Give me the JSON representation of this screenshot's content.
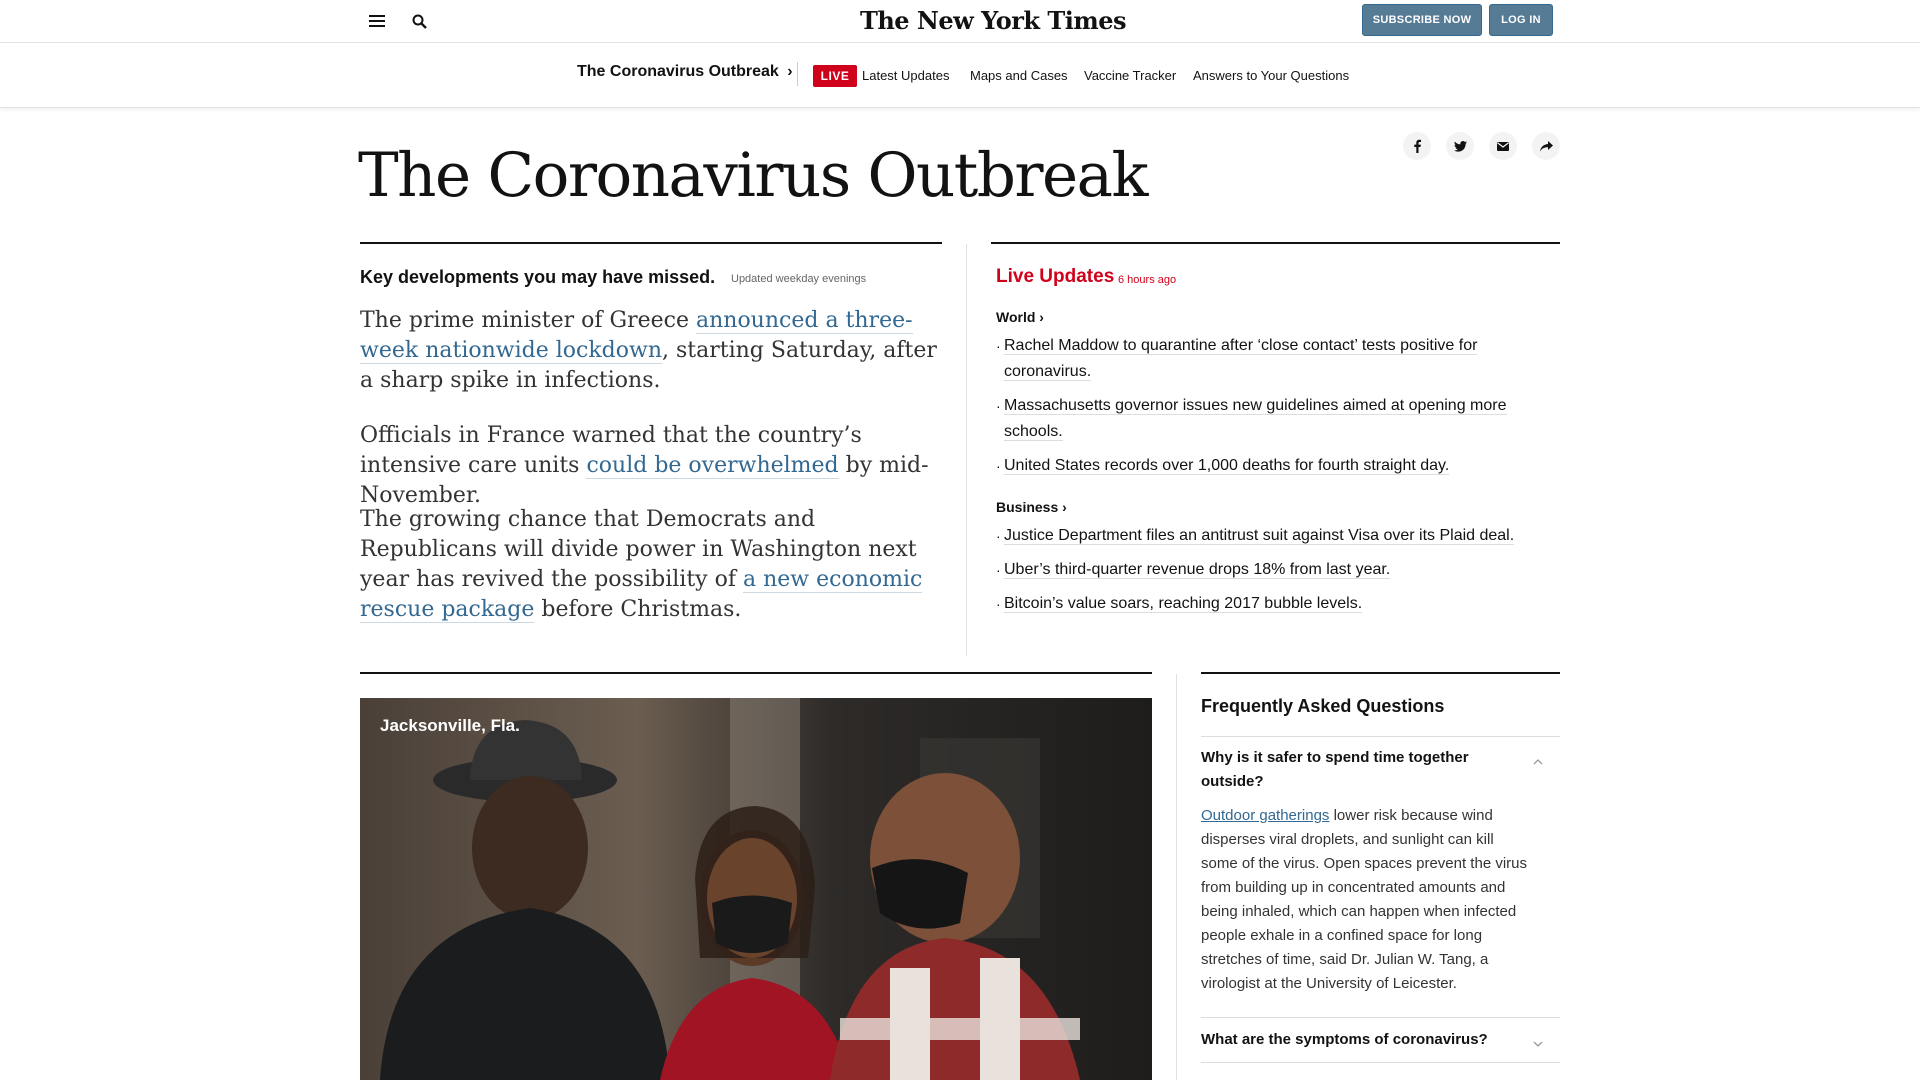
{
  "masthead": {
    "logo": "The New York Times",
    "subscribe_label": "SUBSCRIBE NOW",
    "login_label": "LOG IN"
  },
  "subnav": {
    "section_title": "The Coronavirus Outbreak",
    "live_badge": "LIVE",
    "links": [
      "Latest Updates",
      "Maps and Cases",
      "Vaccine Tracker",
      "Answers to Your Questions"
    ]
  },
  "page": {
    "title": "The Coronavirus Outbreak"
  },
  "key_developments": {
    "heading": "Key developments you may have missed.",
    "updated": "Updated weekday evenings",
    "paragraphs": [
      {
        "pre": "The prime minister of Greece ",
        "link": "announced a three-week nationwide lockdown",
        "post": ", starting Saturday, after a sharp spike in infections."
      },
      {
        "pre": "Officials in France warned that the country’s intensive care units ",
        "link": "could be overwhelmed",
        "post": " by mid-November."
      },
      {
        "pre": "The growing chance that Democrats and Republicans will divide power in Washington next year has revived the possibility of ",
        "link": "a new economic rescue package",
        "post": " before Christmas."
      }
    ]
  },
  "live_updates": {
    "heading": "Live Updates",
    "time": "6 hours ago",
    "sections": [
      {
        "label": "World ›",
        "items": [
          "Rachel Maddow to quarantine after ‘close contact’ tests positive for coronavirus.",
          "Massachusetts governor issues new guidelines aimed at opening more schools.",
          "United States records over 1,000 deaths for fourth straight day."
        ]
      },
      {
        "label": "Business ›",
        "items": [
          "Justice Department files an antitrust suit against Visa over its Plaid deal.",
          "Uber’s third-quarter revenue drops 18% from last year.",
          "Bitcoin’s value soars, reaching 2017 bubble levels."
        ]
      }
    ]
  },
  "photo": {
    "location": "Jacksonville, Fla."
  },
  "faq": {
    "title": "Frequently Asked Questions",
    "questions": [
      {
        "q": "Why is it safer to spend time together outside?",
        "answer_link": "Outdoor gatherings",
        "answer": " lower risk because wind disperses viral droplets, and sunlight can kill some of the virus. Open spaces prevent the virus from building up in concentrated amounts and being inhaled, which can happen when infected people exhale in a confined space for long stretches of time, said Dr. Julian W. Tang, a virologist at the University of Leicester."
      },
      {
        "q": "What are the symptoms of coronavirus?"
      }
    ]
  },
  "colors": {
    "live_red": "#d0021b",
    "link_blue": "#326891",
    "button_blue": "#567b95"
  }
}
